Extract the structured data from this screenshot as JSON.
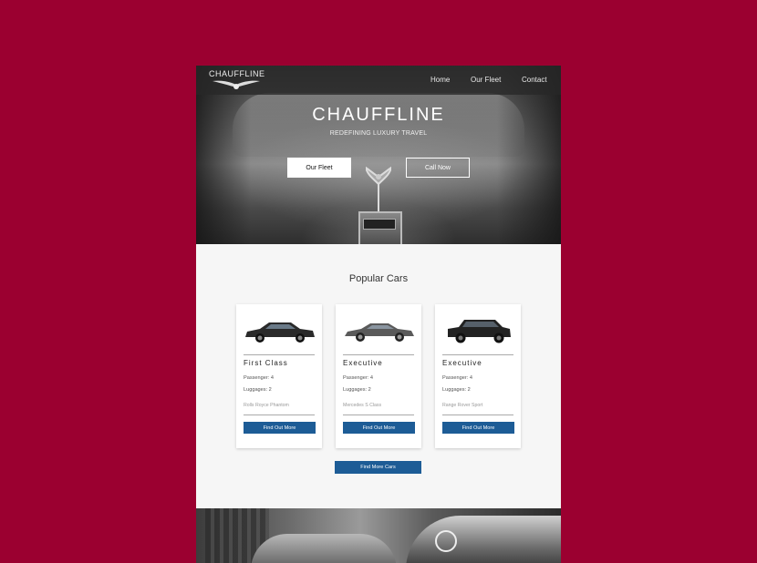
{
  "nav": {
    "logo_text": "CHAUFFLINE",
    "links": [
      "Home",
      "Our Fleet",
      "Contact"
    ]
  },
  "hero": {
    "title": "CHAUFFLINE",
    "tagline": "REDEFINING LUXURY TRAVEL",
    "btn_fleet": "Our Fleet",
    "btn_call": "Call Now"
  },
  "popular": {
    "title": "Popular Cars",
    "cards": [
      {
        "class": "First Class",
        "passengers": "Passenger: 4",
        "luggage": "Luggages: 2",
        "model": "Rolls Royce Phantom",
        "button": "Find Out More",
        "car_color": "#2a2a2a"
      },
      {
        "class": "Executive",
        "passengers": "Passenger: 4",
        "luggage": "Luggages: 2",
        "model": "Mercedes S Class",
        "button": "Find Out More",
        "car_color": "#5a5a5a"
      },
      {
        "class": "Executive",
        "passengers": "Passenger: 4",
        "luggage": "Luggages: 2",
        "model": "Range Rover Sport",
        "button": "Find Out More",
        "car_color": "#222222"
      }
    ],
    "more_button": "Find More Cars"
  },
  "colors": {
    "background": "#9b0030",
    "button_blue": "#1d5c96"
  }
}
